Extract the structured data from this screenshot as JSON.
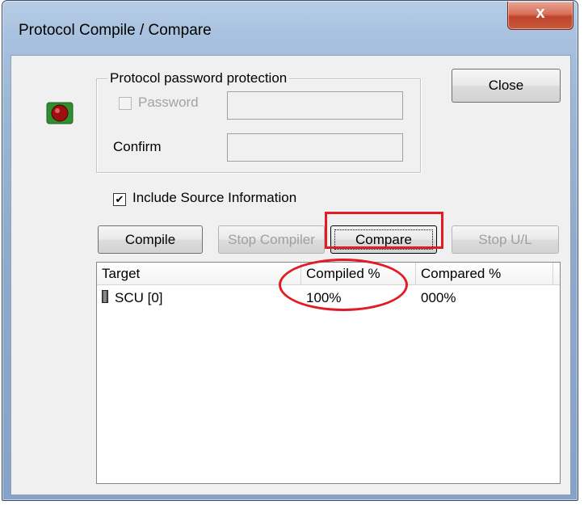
{
  "window": {
    "title": "Protocol Compile / Compare",
    "close_glyph": "x"
  },
  "password_group": {
    "legend": "Protocol password protection",
    "password_label": "Password",
    "password_checked": false,
    "password_enabled": false,
    "password_value": "",
    "confirm_label": "Confirm",
    "confirm_value": ""
  },
  "close_button": {
    "label": "Close"
  },
  "include_source": {
    "label": "Include Source Information",
    "checked": true
  },
  "toolbar": {
    "compile_label": "Compile",
    "stop_compiler_label": "Stop Compiler",
    "compare_label": "Compare",
    "stop_ul_label": "Stop U/L"
  },
  "list": {
    "columns": [
      "Target",
      "Compiled %",
      "Compared %"
    ],
    "rows": [
      {
        "target": "SCU [0]",
        "compiled": "100%",
        "compared": "000%"
      }
    ]
  },
  "annotations": {
    "highlight_color": "#e21b24",
    "highlighted_button": "Compare",
    "highlighted_column": "Compiled %"
  },
  "icons": {
    "app": "red-stop-button-icon",
    "device": "device-icon"
  }
}
